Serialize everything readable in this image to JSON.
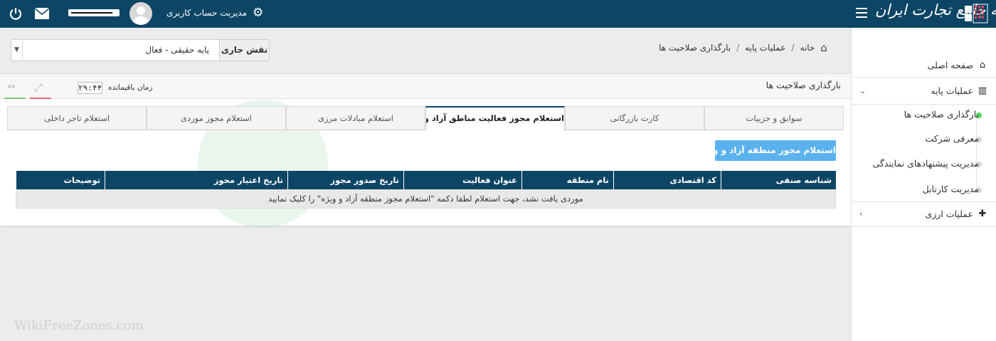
{
  "topbar": {
    "account_label": "مدیریت حساب کاربری",
    "logo_text": "سامانه جامع تجارت ایران"
  },
  "breadcrumb": {
    "home": "خانه",
    "level1": "عملیات پایه",
    "level2": "بارگذاری صلاحیت ها"
  },
  "role": {
    "label": "نقش جاری",
    "value": "پایه حقیقی - فعال"
  },
  "panel": {
    "title": "بارگذاری صلاحیت ها",
    "timer_label": "زمان باقیمانده",
    "timer_value": "۲۹:۴۴"
  },
  "tabs": [
    {
      "label": "سوابق و جزییات"
    },
    {
      "label": "کارت بازرگانی"
    },
    {
      "label": "استعلام مجوز فعالیت مناطق آزاد و ویژه"
    },
    {
      "label": "استعلام مبادلات مرزی"
    },
    {
      "label": "استعلام مجوز موردی"
    },
    {
      "label": "استعلام تاجر داخلی"
    }
  ],
  "active_tab_index": 2,
  "inquiry_button": "استعلام مجوز منطقه آزاد و ویژه",
  "grid": {
    "columns": [
      "شناسه صنفی",
      "کد اقتصادی",
      "نام منطقه",
      "عنوان فعالیت",
      "تاریخ صدور مجوز",
      "تاریخ اعتبار مجوز",
      "توضیحات"
    ],
    "empty_message": "موردی یافت نشد، جهت استعلام لطفا دکمه \"استعلام مجوز منطقه آزاد و ویژه\" را کلیک نمایید"
  },
  "sidebar": {
    "home": "صفحه اصلی",
    "base_ops": "عملیات پایه",
    "sub_items": [
      "بارگذاری صلاحیت ها",
      "معرفی شرکت",
      "مدیریت پیشنهادهای نمایندگی",
      "مدیریت کارتابل"
    ],
    "currency_ops": "عملیات ارزی"
  },
  "watermark": {
    "url_text": "WikiFreeZones.com"
  },
  "colors": {
    "topbar": "#0d4565",
    "accent_button": "#5bb2ee",
    "active_dot": "#4cd964"
  }
}
